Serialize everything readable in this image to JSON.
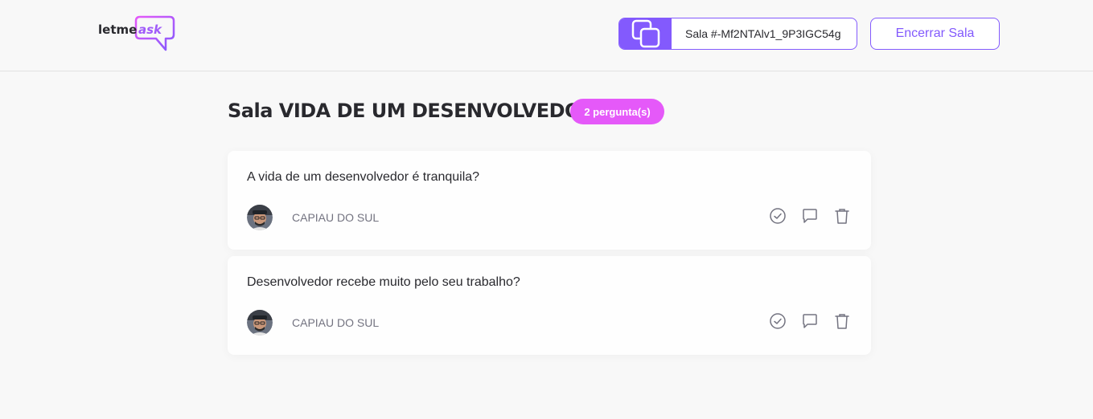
{
  "header": {
    "logo_text": "letmeask",
    "room_code_label": "Sala #-Mf2NTAlv1_9P3IGC54g",
    "end_room_label": "Encerrar Sala"
  },
  "room": {
    "title": "Sala VIDA DE UM DESENVOLVEDOR",
    "question_count": "2 pergunta(s)"
  },
  "questions": [
    {
      "content": "A vida de um desenvolvedor é tranquila?",
      "author": "CAPIAU DO SUL"
    },
    {
      "content": "Desenvolvedor recebe muito pelo seu trabalho?",
      "author": "CAPIAU DO SUL"
    }
  ],
  "colors": {
    "accent": "#835afd",
    "badge": "#e559f9",
    "background": "#f8f8f8",
    "muted_text": "#737380"
  },
  "icons": [
    "logo-icon",
    "copy-icon",
    "check-icon",
    "answer-icon",
    "trash-icon"
  ]
}
